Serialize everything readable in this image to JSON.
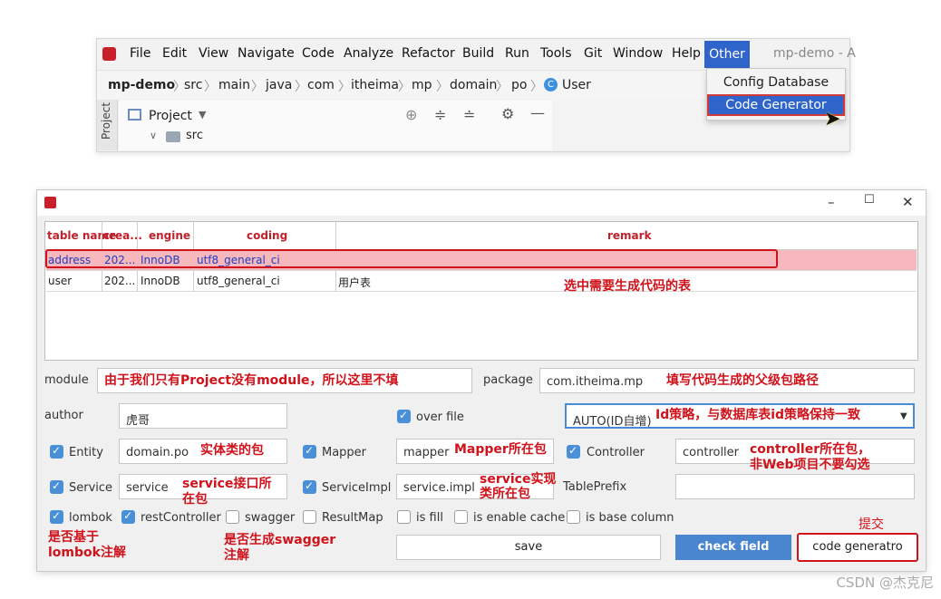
{
  "ide": {
    "menu": [
      "File",
      "Edit",
      "View",
      "Navigate",
      "Code",
      "Analyze",
      "Refactor",
      "Build",
      "Run",
      "Tools",
      "Git",
      "Window",
      "Help",
      "Other"
    ],
    "title": "mp-demo - A",
    "breadcrumb": [
      "mp-demo",
      "src",
      "main",
      "java",
      "com",
      "itheima",
      "mp",
      "domain",
      "po",
      "User"
    ],
    "project_label": "Project",
    "side_label": "Project",
    "tree_src": "src",
    "other_menu": [
      "Config Database",
      "Code Generator"
    ]
  },
  "dialog": {
    "columns": [
      "table name",
      "crea...",
      "engine",
      "coding",
      "remark"
    ],
    "rows": [
      [
        "address",
        "202...",
        "InnoDB",
        "utf8_general_ci",
        ""
      ],
      [
        "user",
        "202...",
        "InnoDB",
        "utf8_general_ci",
        "用户表"
      ]
    ],
    "ann_table": "选中需要生成代码的表",
    "module_label": "module",
    "module_note": "由于我们只有Project没有module，所以这里不填",
    "package_label": "package",
    "package_value": "com.itheima.mp",
    "package_note": "填写代码生成的父级包路径",
    "author_label": "author",
    "author_value": "虎哥",
    "overfile_label": "over file",
    "idtype_value": "AUTO(ID自增)",
    "idtype_note": "Id策略，与数据库表id策略保持一致",
    "entity_label": "Entity",
    "entity_value": "domain.po",
    "entity_note": "实体类的包",
    "mapper_label": "Mapper",
    "mapper_value": "mapper",
    "mapper_note": "Mapper所在包",
    "controller_label": "Controller",
    "controller_value": "controller",
    "controller_note1": "controller所在包，",
    "controller_note2": "非Web项目不要勾选",
    "service_label": "Service",
    "service_value": "service",
    "service_note1": "service接口所",
    "service_note2": "在包",
    "serviceimpl_label": "ServiceImpl",
    "serviceimpl_value": "service.impl",
    "serviceimpl_note1": "service实现",
    "serviceimpl_note2": "类所在包",
    "tableprefix_label": "TablePrefix",
    "lombok_label": "lombok",
    "restcontroller_label": "restController",
    "swagger_label": "swagger",
    "resultmap_label": "ResultMap",
    "isfill_label": "is fill",
    "enablecache_label": "is enable cache",
    "basecolumn_label": "is base column",
    "lombok_note1": "是否基于",
    "lombok_note2": "lombok注解",
    "swagger_note1": "是否生成swagger",
    "swagger_note2": "注解",
    "submit_note": "提交",
    "save_label": "save",
    "checkfield_label": "check field",
    "generate_label": "code generatro"
  },
  "watermark": "CSDN @杰克尼",
  "colors": {
    "accent": "#2f65ca",
    "annotation": "#d0121b",
    "selected_row": "#f7b8bd",
    "check_on": "#4a90d9"
  }
}
